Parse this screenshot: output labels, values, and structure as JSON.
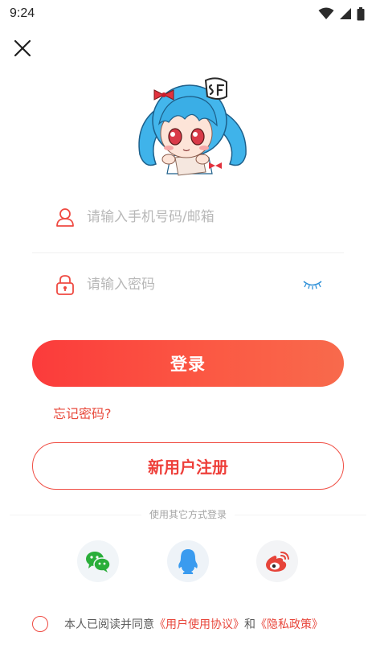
{
  "status_bar": {
    "time": "9:24"
  },
  "form": {
    "phone_placeholder": "请输入手机号码/邮箱",
    "password_placeholder": "请输入密码"
  },
  "actions": {
    "login_label": "登录",
    "forgot_label": "忘记密码?",
    "register_label": "新用户注册"
  },
  "other_login": {
    "label": "使用其它方式登录",
    "providers": [
      "wechat-icon",
      "qq-icon",
      "weibo-icon"
    ]
  },
  "agreement": {
    "prefix": "本人已阅读并同意",
    "terms_link": "《用户使用协议》",
    "connector": "和",
    "privacy_link": "《隐私政策》"
  },
  "colors": {
    "accent": "#fb3b3b",
    "accent_end": "#f86a4c",
    "link": "#e8473c",
    "eye_icon": "#2c8fd8",
    "wechat": "#2aae3a",
    "qq": "#3a9bef",
    "weibo": "#e6443a"
  }
}
